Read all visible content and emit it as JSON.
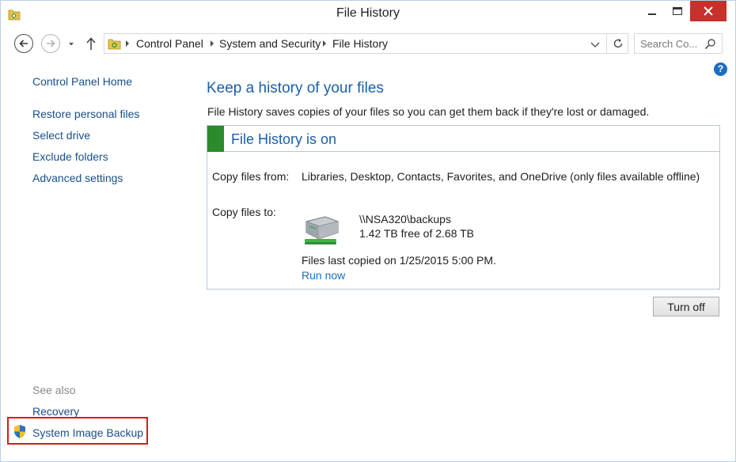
{
  "window": {
    "title": "File History",
    "icons": {
      "app": "file-history-app-icon",
      "minimize": "minimize-icon",
      "maximize": "maximize-icon",
      "close": "close-icon"
    },
    "close_color": "#c7302b"
  },
  "navigation": {
    "breadcrumb": [
      "Control Panel",
      "System and Security",
      "File History"
    ],
    "search_placeholder": "Search Co...",
    "icons": {
      "back": "back-arrow-icon",
      "forward": "forward-arrow-icon",
      "recent": "chevron-down-icon",
      "up": "up-arrow-icon",
      "location": "control-panel-icon",
      "refresh": "refresh-icon",
      "search": "search-icon"
    }
  },
  "help_icon": "?",
  "sidebar": {
    "home": "Control Panel Home",
    "links": [
      "Restore personal files",
      "Select drive",
      "Exclude folders",
      "Advanced settings"
    ],
    "see_also_label": "See also",
    "see_also": [
      "Recovery",
      "System Image Backup"
    ],
    "highlight_color": "#e0161e"
  },
  "main": {
    "heading": "Keep a history of your files",
    "description": "File History saves copies of your files so you can get them back if they're lost or damaged.",
    "status": "File History is on",
    "status_color": "#2b8a2b",
    "copy_from_label": "Copy files from:",
    "copy_from_value": "Libraries, Desktop, Contacts, Favorites, and OneDrive (only files available offline)",
    "copy_to_label": "Copy files to:",
    "drive": {
      "icon": "network-drive-icon",
      "name": "\\\\NSA320\\backups",
      "free": "1.42 TB free of 2.68 TB"
    },
    "last_copied": "Files last copied on 1/25/2015 5:00 PM.",
    "run_now": "Run now",
    "turn_off": "Turn off"
  }
}
